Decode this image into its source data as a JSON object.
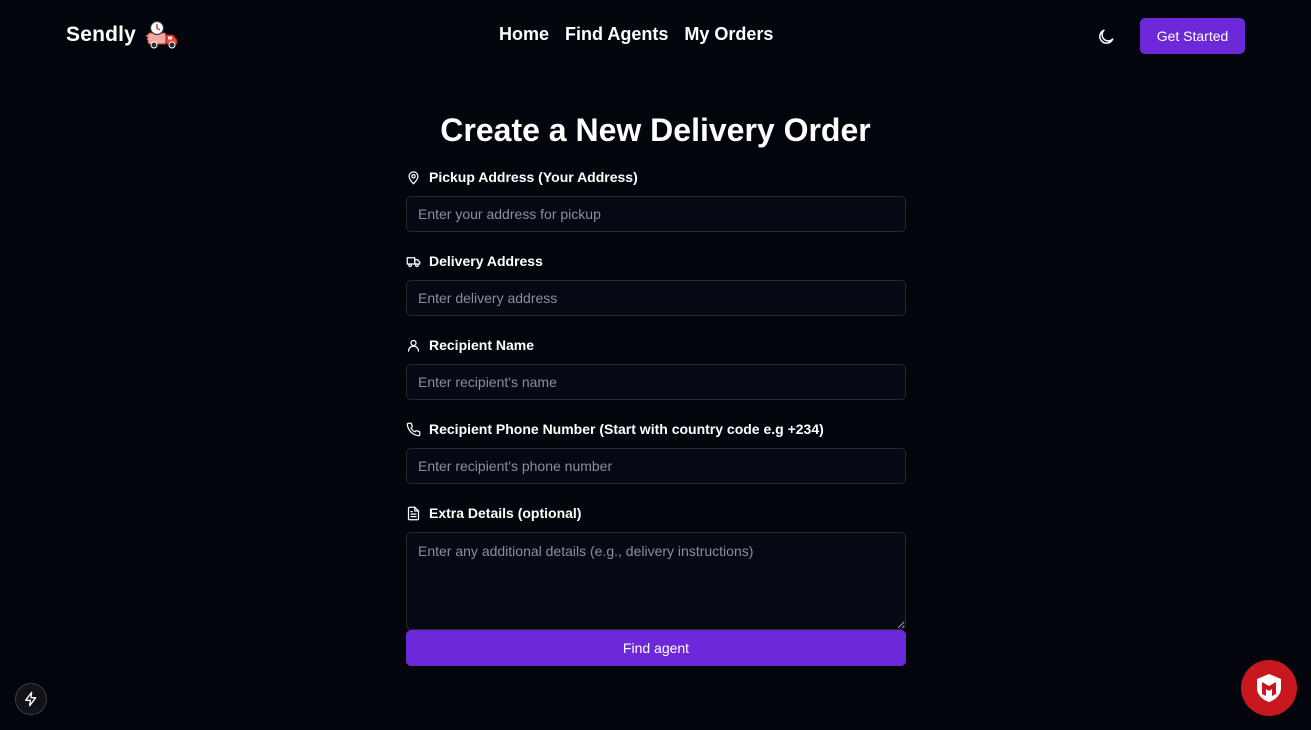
{
  "header": {
    "brand": "Sendly",
    "nav": [
      "Home",
      "Find Agents",
      "My Orders"
    ],
    "cta_label": "Get Started"
  },
  "form": {
    "title": "Create a New Delivery Order",
    "fields": [
      {
        "label": "Pickup Address (Your Address)",
        "placeholder": "Enter your address for pickup",
        "icon": "map-pin-icon"
      },
      {
        "label": "Delivery Address",
        "placeholder": "Enter delivery address",
        "icon": "truck-icon"
      },
      {
        "label": "Recipient Name",
        "placeholder": "Enter recipient's name",
        "icon": "user-icon"
      },
      {
        "label": "Recipient Phone Number (Start with country code e.g +234)",
        "placeholder": "Enter recipient's phone number",
        "icon": "phone-icon"
      },
      {
        "label": "Extra Details (optional)",
        "placeholder": "Enter any additional details (e.g., delivery instructions)",
        "icon": "document-icon"
      }
    ],
    "submit_label": "Find agent"
  },
  "colors": {
    "background": "#03050d",
    "accent": "#6d28d9",
    "badge": "#c8171e"
  }
}
